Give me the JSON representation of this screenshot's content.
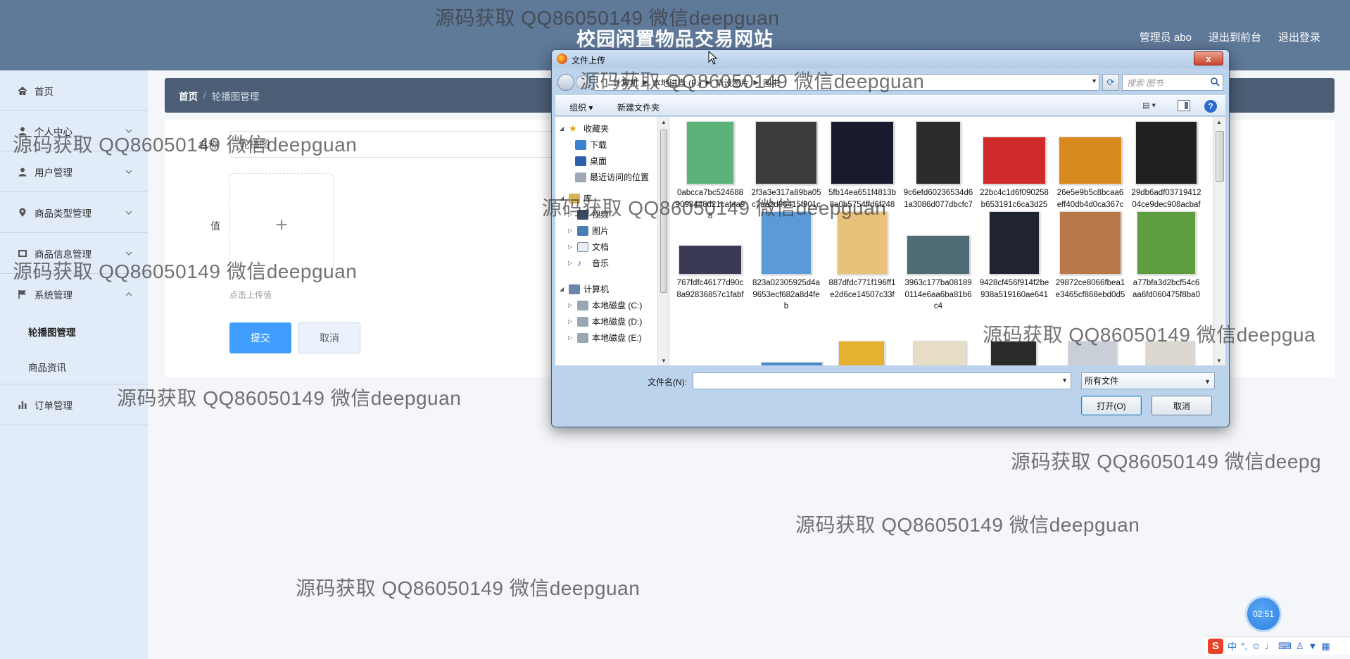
{
  "header": {
    "site_title": "校园闲置物品交易网站",
    "admin_label": "管理员 abo",
    "front_link": "退出到前台",
    "logout_link": "退出登录"
  },
  "sidebar": {
    "items": [
      {
        "label": "首页",
        "icon": "home-icon"
      },
      {
        "label": "个人中心",
        "icon": "user-icon"
      },
      {
        "label": "用户管理",
        "icon": "user-icon"
      },
      {
        "label": "商品类型管理",
        "icon": "location-pin-icon"
      },
      {
        "label": "商品信息管理",
        "icon": "grid-icon"
      },
      {
        "label": "系统管理",
        "icon": "flag-icon"
      },
      {
        "label": "订单管理",
        "icon": "bar-chart-icon"
      }
    ],
    "system_submenu": [
      "轮播图管理",
      "商品资讯"
    ]
  },
  "breadcrumb": {
    "home": "首页",
    "separator": "/",
    "current": "轮播图管理"
  },
  "form": {
    "name_label": "名称",
    "name_value": "轮播图",
    "value_label": "值",
    "upload_tip": "点击上传值",
    "submit_label": "提交",
    "cancel_label": "取消"
  },
  "dialog": {
    "title": "文件上传",
    "close_label": "x",
    "path": [
      "计算机",
      "本地磁盘 (F:)",
      "毕设图片",
      "图书"
    ],
    "search_placeholder": "搜索 图书",
    "toolbar": {
      "organize": "组织 ▾",
      "new_folder": "新建文件夹",
      "help": "?"
    },
    "nav_tree": {
      "favorites": "收藏夹",
      "favorites_items": [
        "下载",
        "桌面",
        "最近访问的位置"
      ],
      "libraries": "库",
      "libraries_items": [
        "视频",
        "图片",
        "文档",
        "音乐"
      ],
      "computer": "计算机",
      "computer_items": [
        "本地磁盘 (C:)",
        "本地磁盘 (D:)",
        "本地磁盘 (E:)"
      ]
    },
    "files": [
      {
        "name": "0abcca7bc5246889098448d21cafea98",
        "color": "#5bb37a"
      },
      {
        "name": "2f3a3e317a89ba05c7aa2d96415f901c",
        "color": "#3b3b3b"
      },
      {
        "name": "5fb14ea651f4813b8e0b5754ffd6f248",
        "color": "#1a1a2e"
      },
      {
        "name": "9c6efd60236534d61a3086d077dbcfc7",
        "color": "#2c2c2c"
      },
      {
        "name": "22bc4c1d6f090258b653191c6ca3d25e",
        "color": "#d12a2a"
      },
      {
        "name": "26e5e9b5c8bcaa6eff40db4d0ca367c2",
        "color": "#d98a1f"
      },
      {
        "name": "29db6adf0371941204ce9dec908acbaf",
        "color": "#202020"
      },
      {
        "name": "767fdfc46177d90c8a92836857c1fabf",
        "color": "#3a3a55"
      },
      {
        "name": "823a02305925d4a9653ecf682a8d4feb",
        "color": "#5a9ad6"
      },
      {
        "name": "887dfdc771f196ff1e2d6ce14507c33f",
        "color": "#e8c27a"
      },
      {
        "name": "3963c177ba081890114e6aa6ba81b6c4",
        "color": "#4f6b75"
      },
      {
        "name": "9428cf456f914f2be938a519160ae641",
        "color": "#1f2430"
      },
      {
        "name": "29872ce8066fbea1e3465cf868ebd0d5",
        "color": "#b7784a"
      },
      {
        "name": "a77bfa3d2bcf54c6aa6fd060475f8ba0",
        "color": "#5e9d3f"
      }
    ],
    "filename_label": "文件名(N):",
    "filename_value": "",
    "filter_value": "所有文件",
    "open_label": "打开(O)",
    "cancel_label": "取消"
  },
  "watermark": "源码获取 QQ86050149 微信deepguan",
  "watermark_cut_1": "源码获取 QQ86050149 微信deepgua",
  "watermark_cut_2": "源码获取 QQ86050149 微信deepg",
  "timer": "02:51",
  "ime": {
    "logo": "S",
    "mode": "中"
  }
}
